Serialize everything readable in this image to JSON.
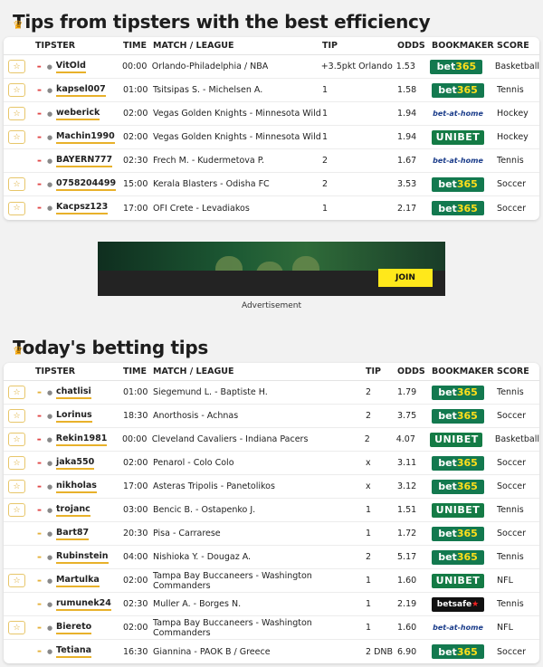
{
  "section1": {
    "title": "Tips from tipsters with the best efficiency",
    "headers": {
      "tipster": "TIPSTER",
      "time": "TIME",
      "match": "MATCH / LEAGUE",
      "tip": "TIP",
      "odds": "ODDS",
      "bookmaker": "BOOKMAKER",
      "score": "SCORE"
    },
    "rows": [
      {
        "fav": true,
        "trend": "down",
        "user": "VitOld",
        "time": "00:00",
        "match": "Orlando-Philadelphia / NBA",
        "tip": "+3.5pkt Orlando",
        "odds": "1.53",
        "bookmaker": "bet365",
        "score": "Basketball"
      },
      {
        "fav": true,
        "trend": "down",
        "user": "kapsel007",
        "time": "01:00",
        "match": "Tsitsipas S. - Michelsen A.",
        "tip": "1",
        "odds": "1.58",
        "bookmaker": "bet365",
        "score": "Tennis"
      },
      {
        "fav": true,
        "trend": "down",
        "user": "weberick",
        "time": "02:00",
        "match": "Vegas Golden Knights - Minnesota Wild",
        "tip": "1",
        "odds": "1.94",
        "bookmaker": "bet-at-home",
        "score": "Hockey"
      },
      {
        "fav": true,
        "trend": "down",
        "user": "Machin1990",
        "time": "02:00",
        "match": "Vegas Golden Knights - Minnesota Wild",
        "tip": "1",
        "odds": "1.94",
        "bookmaker": "UNIBET",
        "score": "Hockey"
      },
      {
        "fav": false,
        "trend": "down",
        "user": "BAYERN777",
        "time": "02:30",
        "match": "Frech M. - Kudermetova P.",
        "tip": "2",
        "odds": "1.67",
        "bookmaker": "bet-at-home",
        "score": "Tennis"
      },
      {
        "fav": true,
        "trend": "down",
        "user": "0758204499",
        "time": "15:00",
        "match": "Kerala Blasters - Odisha FC",
        "tip": "2",
        "odds": "3.53",
        "bookmaker": "bet365",
        "score": "Soccer"
      },
      {
        "fav": true,
        "trend": "down",
        "user": "Kacpsz123",
        "time": "17:00",
        "match": "OFI Crete - Levadiakos",
        "tip": "1",
        "odds": "2.17",
        "bookmaker": "bet365",
        "score": "Soccer"
      }
    ]
  },
  "ad": {
    "join_label": "JOIN",
    "caption": "Advertisement"
  },
  "section2": {
    "title": "Today's betting tips",
    "headers": {
      "tipster": "TIPSTER",
      "time": "TIME",
      "match": "MATCH / LEAGUE",
      "tip": "TIP",
      "odds": "ODDS",
      "bookmaker": "BOOKMAKER",
      "score": "SCORE"
    },
    "rows": [
      {
        "fav": true,
        "trend": "up",
        "user": "chatlisi",
        "time": "01:00",
        "match": "Siegemund L. - Baptiste H.",
        "tip": "2",
        "odds": "1.79",
        "bookmaker": "bet365",
        "score": "Tennis"
      },
      {
        "fav": true,
        "trend": "down",
        "user": "Lorinus",
        "time": "18:30",
        "match": "Anorthosis - Achnas",
        "tip": "2",
        "odds": "3.75",
        "bookmaker": "bet365",
        "score": "Soccer"
      },
      {
        "fav": true,
        "trend": "down",
        "user": "Rekin1981",
        "time": "00:00",
        "match": "Cleveland Cavaliers - Indiana Pacers",
        "tip": "2",
        "odds": "4.07",
        "bookmaker": "UNIBET",
        "score": "Basketball"
      },
      {
        "fav": true,
        "trend": "down",
        "user": "jaka550",
        "time": "02:00",
        "match": "Penarol - Colo Colo",
        "tip": "x",
        "odds": "3.11",
        "bookmaker": "bet365",
        "score": "Soccer"
      },
      {
        "fav": true,
        "trend": "down",
        "user": "nikholas",
        "time": "17:00",
        "match": "Asteras Tripolis - Panetolikos",
        "tip": "x",
        "odds": "3.12",
        "bookmaker": "bet365",
        "score": "Soccer"
      },
      {
        "fav": true,
        "trend": "down",
        "user": "trojanc",
        "time": "03:00",
        "match": "Bencic B. - Ostapenko J.",
        "tip": "1",
        "odds": "1.51",
        "bookmaker": "UNIBET",
        "score": "Tennis"
      },
      {
        "fav": false,
        "trend": "up",
        "user": "Bart87",
        "time": "20:30",
        "match": "Pisa - Carrarese",
        "tip": "1",
        "odds": "1.72",
        "bookmaker": "bet365",
        "score": "Soccer"
      },
      {
        "fav": false,
        "trend": "up",
        "user": "Rubinstein",
        "time": "04:00",
        "match": "Nishioka Y. - Dougaz A.",
        "tip": "2",
        "odds": "5.17",
        "bookmaker": "bet365",
        "score": "Tennis"
      },
      {
        "fav": true,
        "trend": "up",
        "user": "Martulka",
        "time": "02:00",
        "match": "Tampa Bay Buccaneers - Washington Commanders",
        "tip": "1",
        "odds": "1.60",
        "bookmaker": "UNIBET",
        "score": "NFL"
      },
      {
        "fav": false,
        "trend": "up",
        "user": "rumunek24",
        "time": "02:30",
        "match": "Muller A. - Borges N.",
        "tip": "1",
        "odds": "2.19",
        "bookmaker": "betsafe",
        "score": "Tennis"
      },
      {
        "fav": true,
        "trend": "up",
        "user": "Biereto",
        "time": "02:00",
        "match": "Tampa Bay Buccaneers - Washington Commanders",
        "tip": "1",
        "odds": "1.60",
        "bookmaker": "bet-at-home",
        "score": "NFL"
      },
      {
        "fav": false,
        "trend": "up",
        "user": "Tetiana",
        "time": "16:30",
        "match": "Giannina - PAOK B / Greece",
        "tip": "2 DNB",
        "odds": "6.90",
        "bookmaker": "bet365",
        "score": "Soccer"
      }
    ]
  },
  "colors": {
    "accent": "#e8b12a",
    "bet365": "#13794f",
    "unibet": "#147b45"
  }
}
